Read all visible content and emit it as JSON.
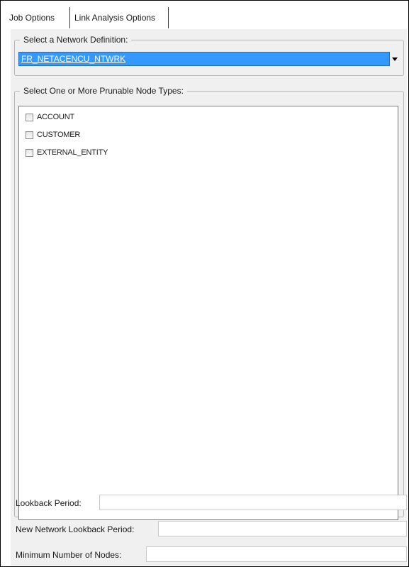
{
  "tabs": [
    {
      "label": "Job Options"
    },
    {
      "label": "Link Analysis Options"
    }
  ],
  "network": {
    "legend": "Select a Network Definition:",
    "selected": "FR_NETACENCU_NTWRK"
  },
  "node_types": {
    "legend": "Select One or More Prunable Node Types:",
    "items": [
      {
        "label": "ACCOUNT",
        "checked": false
      },
      {
        "label": "CUSTOMER",
        "checked": false
      },
      {
        "label": "EXTERNAL_ENTITY",
        "checked": false
      }
    ]
  },
  "fields": {
    "lookback_period": {
      "label": "Lookback Period:",
      "value": ""
    },
    "new_network_lookback_period": {
      "label": "New Network Lookback Period:",
      "value": ""
    },
    "minimum_number_of_nodes": {
      "label": "Minimum Number of Nodes:",
      "value": ""
    }
  },
  "colors": {
    "selection_background": "#3399ff",
    "panel_background": "#f0f0f0"
  },
  "icons": {
    "dropdown": "chevron-down-icon"
  }
}
